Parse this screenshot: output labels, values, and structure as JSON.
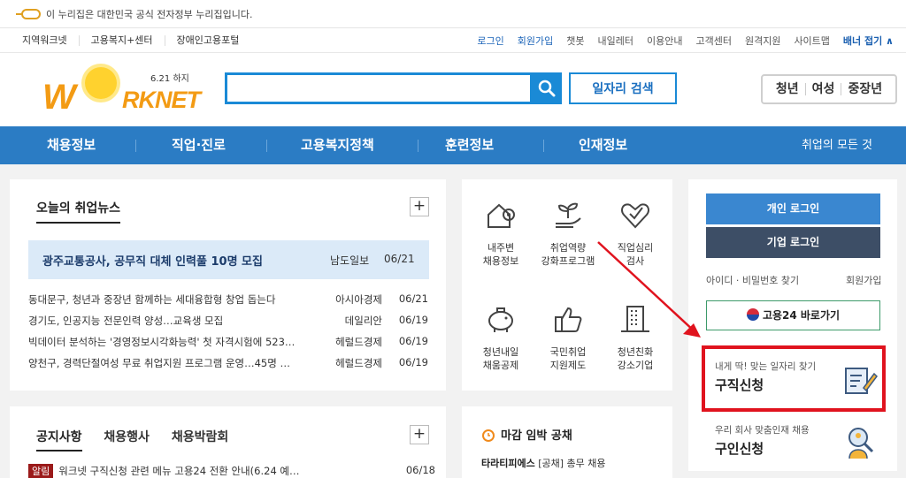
{
  "gov_banner": {
    "text": "이 누리집은 대한민국 공식 전자정부 누리집입니다."
  },
  "util_left": [
    "지역워크넷",
    "고용복지+센터",
    "장애인고용포털"
  ],
  "util_right": {
    "login": "로그인",
    "signup": "회원가입",
    "items": [
      "챗봇",
      "내일레터",
      "이용안내",
      "고객센터",
      "원격지원",
      "사이트맵"
    ],
    "banner_toggle": "배너 접기 ∧"
  },
  "logo": {
    "date": "6.21 하지",
    "text": "RKNET",
    "w": "W"
  },
  "search": {
    "placeholder": "",
    "value": "",
    "button_label": "일자리 검색"
  },
  "age_tabs": [
    "청년",
    "여성",
    "중장년"
  ],
  "gnb": {
    "items": [
      "채용정보",
      "직업·진로",
      "고용복지정책",
      "훈련정보",
      "인재정보"
    ],
    "all_menu": "취업의 모든 것"
  },
  "news": {
    "title": "오늘의 취업뉴스",
    "headline": {
      "title": "광주교통공사, 공무직 대체 인력풀 10명 모집",
      "source": "남도일보",
      "date": "06/21"
    },
    "rows": [
      {
        "title": "동대문구, 청년과 중장년 함께하는 세대융합형 창업 돕는다",
        "source": "아시아경제",
        "date": "06/21"
      },
      {
        "title": "경기도, 인공지능 전문인력 양성…교육생 모집",
        "source": "데일리안",
        "date": "06/19"
      },
      {
        "title": "빅데이터 분석하는 '경영정보시각화능력' 첫 자격시험에 523…",
        "source": "헤럴드경제",
        "date": "06/19"
      },
      {
        "title": "양천구, 경력단절여성 무료 취업지원 프로그램 운영…45명 …",
        "source": "헤럴드경제",
        "date": "06/19"
      }
    ]
  },
  "services": [
    {
      "line1": "내주변",
      "line2": "채용정보"
    },
    {
      "line1": "취업역량",
      "line2": "강화프로그램"
    },
    {
      "line1": "직업심리",
      "line2": "검사"
    },
    {
      "line1": "청년내일",
      "line2": "채움공제"
    },
    {
      "line1": "국민취업",
      "line2": "지원제도"
    },
    {
      "line1": "청년친화",
      "line2": "강소기업"
    }
  ],
  "login": {
    "personal": "개인 로그인",
    "company": "기업 로그인",
    "find": "아이디 · 비밀번호 찾기",
    "join": "회원가입",
    "gov24": "고용24 바로가기"
  },
  "cards": [
    {
      "sub": "내게 딱! 맞는 일자리 찾기",
      "main": "구직신청"
    },
    {
      "sub": "우리 회사 맞춤인재 채용",
      "main": "구인신청"
    }
  ],
  "notice": {
    "tabs": [
      "공지사항",
      "채용행사",
      "채용박람회"
    ],
    "row": {
      "badge": "알림",
      "title": "워크넷 구직신청 관련 메뉴 고용24 전환 안내(6.24 예…",
      "date": "06/18"
    }
  },
  "deadline": {
    "title": "마감 임박 공채",
    "company": "타라티피에스",
    "text": "[공채] 총무 채용"
  },
  "colors": {
    "primary": "#2b7cc4",
    "highlight": "#e0131e",
    "company_btn": "#3d4e66"
  }
}
